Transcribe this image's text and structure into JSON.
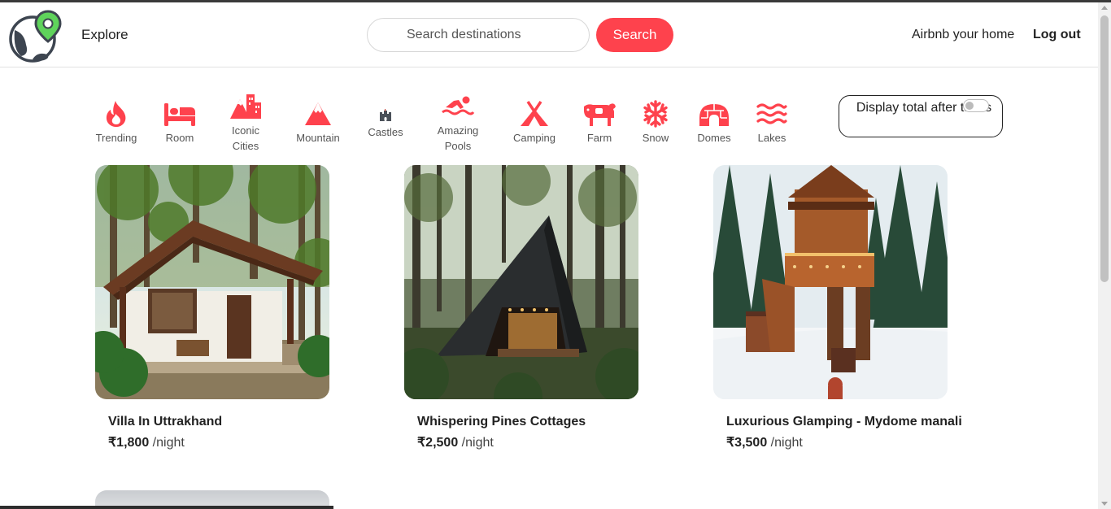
{
  "header": {
    "explore_label": "Explore",
    "search_placeholder": "Search destinations",
    "search_button": "Search",
    "host_link": "Airbnb your home",
    "logout_link": "Log out"
  },
  "filters": [
    {
      "label": "Trending",
      "icon": "fire-icon"
    },
    {
      "label": "Room",
      "icon": "bed-icon"
    },
    {
      "label": "Iconic Cities",
      "icon": "mountain-city-icon"
    },
    {
      "label": "Mountain",
      "icon": "mountain-icon"
    },
    {
      "label": "Castles",
      "icon": "castle-icon"
    },
    {
      "label": "Amazing Pools",
      "icon": "person-swimming-icon"
    },
    {
      "label": "Camping",
      "icon": "campground-icon"
    },
    {
      "label": "Farm",
      "icon": "cow-icon"
    },
    {
      "label": "Snow",
      "icon": "snowflake-icon"
    },
    {
      "label": "Domes",
      "icon": "igloo-icon"
    },
    {
      "label": "Lakes",
      "icon": "water-icon"
    }
  ],
  "tax_toggle": {
    "label": "Display total after taxes",
    "enabled": false
  },
  "listings": [
    {
      "title": "Villa In Uttrakhand",
      "price": "₹1,800",
      "per": " /night"
    },
    {
      "title": "Whispering Pines Cottages",
      "price": "₹2,500",
      "per": " /night"
    },
    {
      "title": "Luxurious Glamping - Mydome manali",
      "price": "₹3,500",
      "per": " /night"
    }
  ],
  "colors": {
    "accent": "#fe424d",
    "logo_pin": "#5fd35b",
    "text": "#222222"
  }
}
